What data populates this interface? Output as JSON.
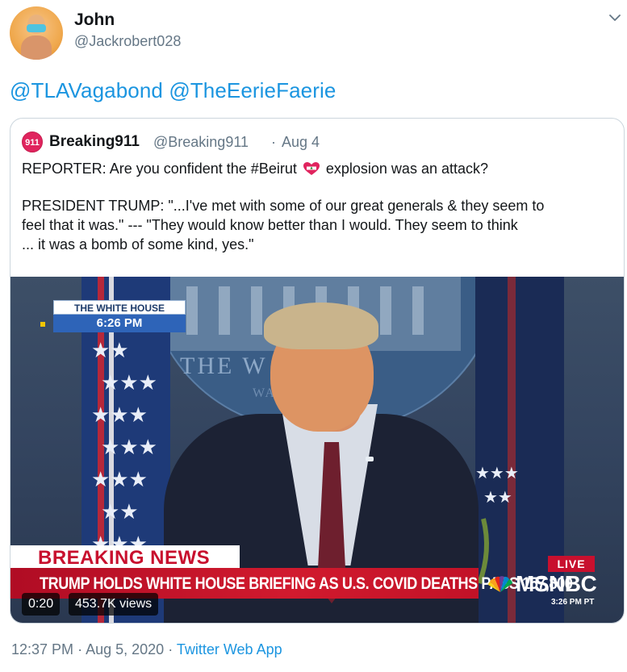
{
  "author": {
    "display_name": "John",
    "handle": "@Jackrobert028"
  },
  "tweet": {
    "mentions": [
      "@TLAVagabond",
      "@TheEerieFaerie"
    ]
  },
  "quoted_tweet": {
    "avatar_text": "911",
    "display_name": "Breaking911",
    "handle": "@Breaking911",
    "separator": "·",
    "date": "Aug 4",
    "line1_before": "REPORTER: Are you confident the #Beirut",
    "line1_after": "explosion was an attack?",
    "para2_line1": "PRESIDENT TRUMP: \"...I've met with some of our great generals & they seem to",
    "para2_line2": "feel that it was.\" --- \"They would know better than I would. They seem to think",
    "para2_line3": "... it was a bomb of some kind, yes.\""
  },
  "video": {
    "location_label": "THE WHITE HOUSE",
    "location_time": "6:26 PM",
    "seal_text": "THE W    HOUSE",
    "seal_text2": "WA        N",
    "breaking_label": "BREAKING NEWS",
    "headline": "TRUMP HOLDS WHITE HOUSE BRIEFING AS U.S. COVID DEATHS PASS 157,800",
    "live_label": "LIVE",
    "network": "MSNBC",
    "network_time": "3:26 PM PT",
    "elapsed": "0:20",
    "views": "453.7K views"
  },
  "footer": {
    "time": "12:37 PM",
    "separator": "·",
    "date": "Aug 5, 2020",
    "app": "Twitter Web App"
  },
  "colors": {
    "link": "#1b95e0",
    "secondary_text": "#657786",
    "border": "#ccd6dd",
    "breaking_red": "#c8102e"
  },
  "icons": {
    "menu": "chevron-down-icon",
    "flag": "lebanon-flag-heart-icon",
    "network_logo": "peacock-icon"
  }
}
